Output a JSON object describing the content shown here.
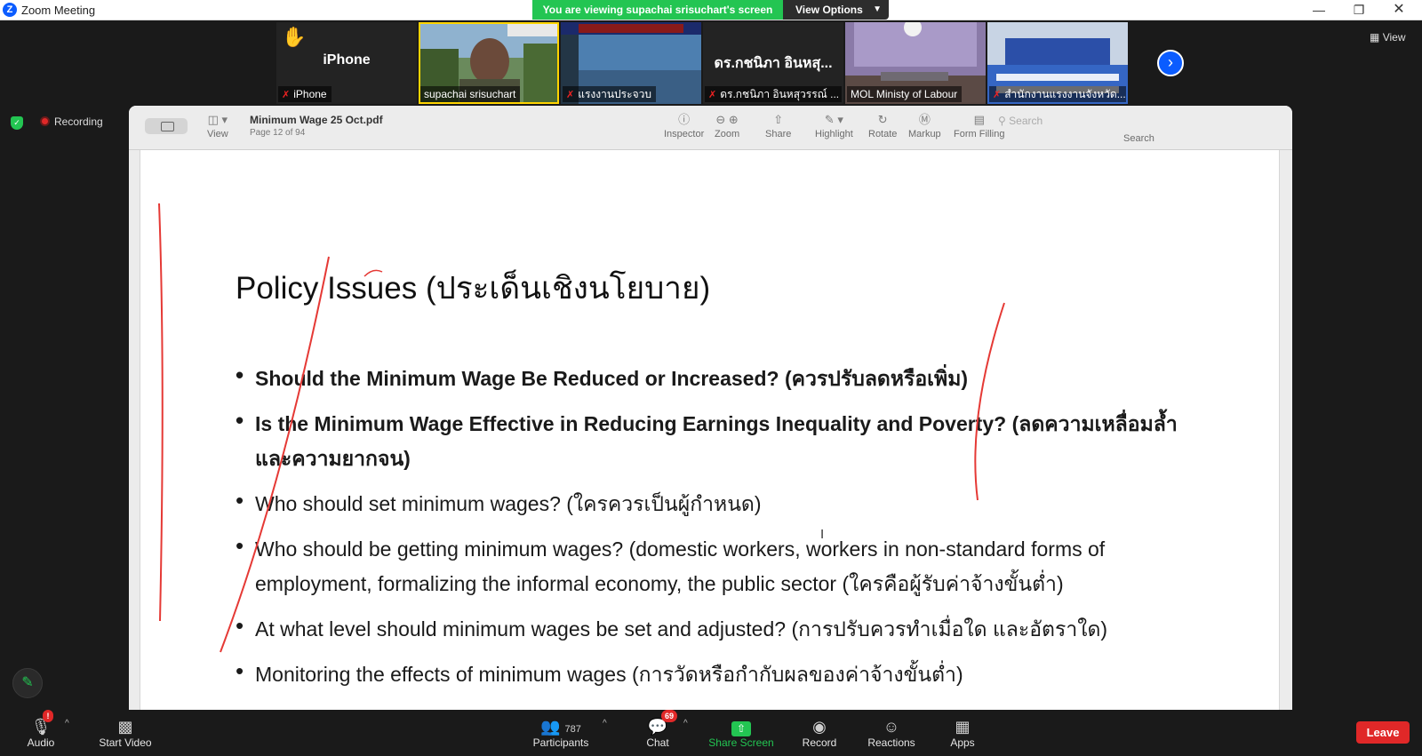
{
  "window": {
    "title": "Zoom Meeting"
  },
  "banner": {
    "viewing_text": "You are viewing supachai srisuchart's screen",
    "view_options_label": "View Options"
  },
  "thumbnails": [
    {
      "name": "iPhone",
      "big_name": "iPhone",
      "muted": true,
      "hand_raised": true
    },
    {
      "name": "supachai srisuchart",
      "muted": false,
      "active": true
    },
    {
      "name": "แรงงานประจวบ",
      "muted": true
    },
    {
      "name": "ดร.กชนิภา อินหสุวรรณ์ ...",
      "big_name": "ดร.กชนิภา อินหสุ...",
      "muted": true
    },
    {
      "name": "MOL Ministy of Labour",
      "muted": false
    },
    {
      "name": "สำนักงานแรงงานจังหวัด...",
      "muted": true
    }
  ],
  "view_button_label": "View",
  "recording_label": "Recording",
  "pdf": {
    "file_name": "Minimum Wage 25 Oct.pdf",
    "page_info": "Page 12 of 94",
    "toolbar": {
      "view": "View",
      "inspector": "Inspector",
      "zoom": "Zoom",
      "share": "Share",
      "highlight": "Highlight",
      "rotate": "Rotate",
      "markup": "Markup",
      "form_filling": "Form Filling",
      "search_placeholder": "Search",
      "search_label": "Search"
    },
    "slide": {
      "title": "Policy Issues (ประเด็นเชิงนโยบาย)",
      "bullets": [
        {
          "text": "Should the Minimum Wage Be Reduced or Increased? (ควรปรับลดหรือเพิ่ม)",
          "bold": true
        },
        {
          "text": "Is the Minimum Wage Effective in Reducing Earnings Inequality and Poverty? (ลดความเหลื่อมล้ำและความยากจน)",
          "bold": true
        },
        {
          "text": "Who should set minimum wages? (ใครควรเป็นผู้กำหนด)",
          "bold": false
        },
        {
          "text": "Who should be getting minimum wages? (domestic workers, workers in non-standard forms of employment, formalizing the informal economy, the public sector (ใครคือผู้รับค่าจ้างขั้นต่ำ)",
          "bold": false
        },
        {
          "text": "At what level should minimum wages be set and adjusted? (การปรับควรทำเมื่อใด และอัตราใด)",
          "bold": false
        },
        {
          "text": "Monitoring the effects of minimum wages (การวัดหรือกำกับผลของค่าจ้างขั้นต่ำ)",
          "bold": false
        }
      ]
    }
  },
  "bottombar": {
    "audio": "Audio",
    "audio_alert": "!",
    "start_video": "Start Video",
    "participants": "Participants",
    "participant_count": "787",
    "chat": "Chat",
    "chat_badge": "69",
    "share_screen": "Share Screen",
    "record": "Record",
    "reactions": "Reactions",
    "apps": "Apps",
    "leave": "Leave"
  },
  "colors": {
    "accent_green": "#23c552",
    "zoom_blue": "#0b5cff",
    "leave_red": "#e02828",
    "annotation_red": "#e53935"
  }
}
